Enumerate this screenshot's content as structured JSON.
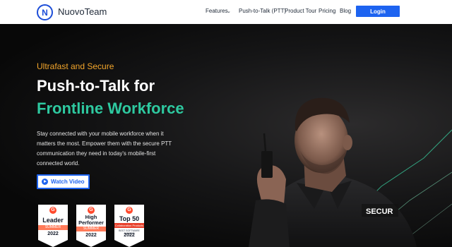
{
  "header": {
    "brand": "NuovoTeam",
    "nav": {
      "features": "Features",
      "ptt": "Push-to-Talk (PTT)",
      "tour": "Product Tour",
      "pricing": "Pricing",
      "blog": "Blog"
    },
    "login": "Login"
  },
  "hero": {
    "eyebrow": "Ultrafast and Secure",
    "title_line1": "Push-to-Talk for",
    "title_line2": "Frontline Workforce",
    "description": "Stay connected with your mobile workforce when it matters the most. Empower them with the secure PTT communication they need in today's mobile-first connected world.",
    "watch_video": "Watch Video",
    "vest_text": "SECUR"
  },
  "badges": [
    {
      "title": "Leader",
      "ribbon": "SUMMER",
      "year": "2022"
    },
    {
      "title": "High Performer",
      "title_l1": "High",
      "title_l2": "Performer",
      "ribbon": "SUMMER",
      "year": "2022"
    },
    {
      "title": "Top 50",
      "ribbon": "Collaboration Products",
      "sub": "BEST SOFTWARE AWARDS",
      "year": "2022"
    }
  ],
  "colors": {
    "accent_blue": "#1d63f0",
    "accent_green": "#2ec9a0",
    "accent_orange": "#f2a52b",
    "g2_red": "#ff492c"
  }
}
